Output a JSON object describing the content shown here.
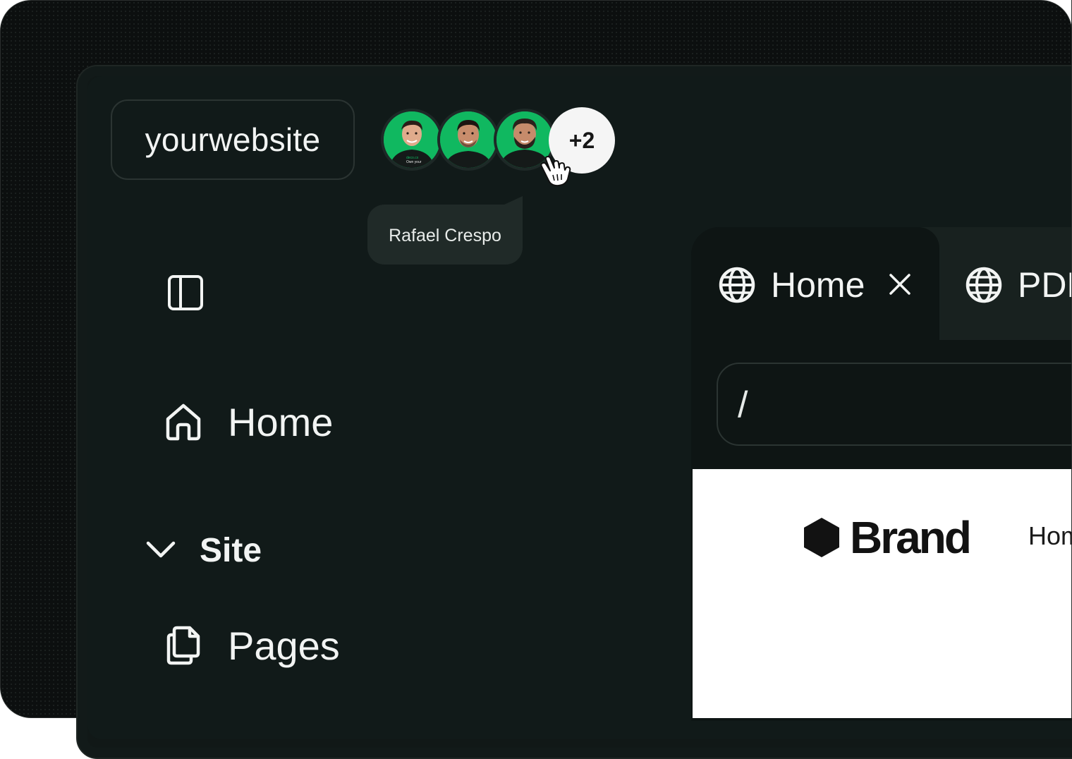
{
  "site": {
    "name": "yourwebsite"
  },
  "collaborators": {
    "avatars": [
      "avatar-1",
      "avatar-2",
      "avatar-3"
    ],
    "more_count": "+2",
    "tooltip_name": "Rafael Crespo",
    "shirt_text": [
      "deco.cx",
      "Own your"
    ]
  },
  "sidebar": {
    "toggle_icon": "sidebar-panel-icon",
    "items": [
      {
        "label": "Home",
        "icon": "home-icon"
      }
    ],
    "section": {
      "label": "Site",
      "icon": "chevron-down-icon"
    },
    "section_items": [
      {
        "label": "Pages",
        "icon": "pages-icon"
      }
    ]
  },
  "tabs": [
    {
      "label": "Home",
      "icon": "globe-icon",
      "closable": true,
      "active": true
    },
    {
      "label": "PDP",
      "icon": "globe-icon",
      "closable": false,
      "active": false
    }
  ],
  "url_bar": {
    "value": "/"
  },
  "preview": {
    "brand": "Brand",
    "nav_first": "Home"
  },
  "colors": {
    "background": "#0c0f0f",
    "panel": "#111a19",
    "accent_green": "#10b860",
    "text": "#f2f4f3"
  }
}
